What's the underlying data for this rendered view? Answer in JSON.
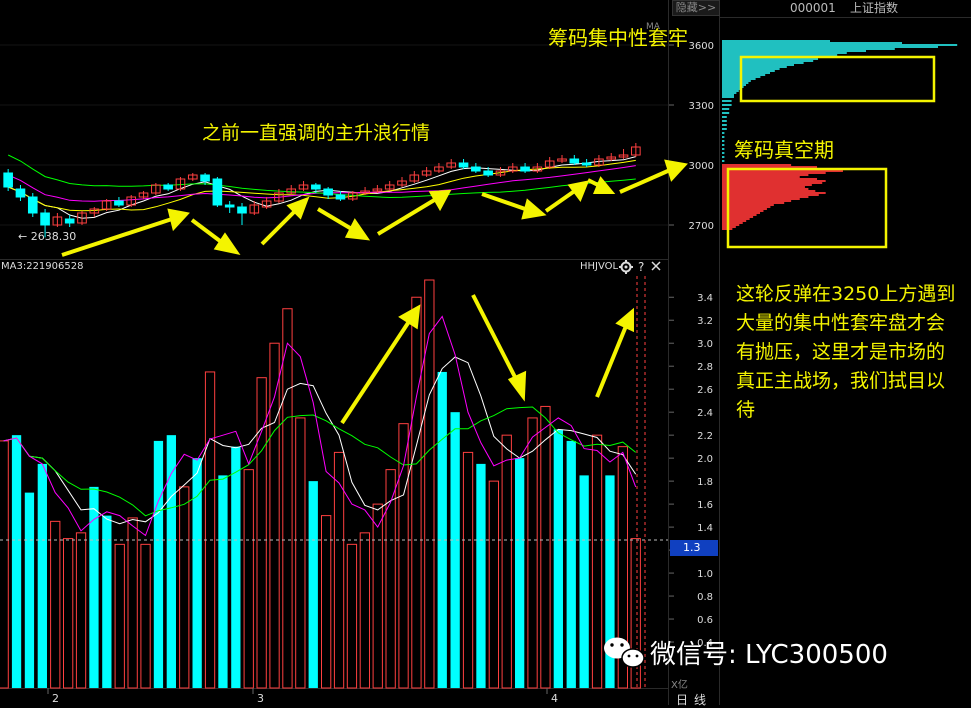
{
  "toolbar": {
    "hide_label": "隐藏>>"
  },
  "stock": {
    "code": "000001",
    "name": "上证指数"
  },
  "annotations": {
    "trapped": "筹码集中性套牢",
    "uptrend": "之前一直强调的主升浪行情",
    "vacuum": "筹码真空期",
    "note": "这轮反弹在3250上方遇到大量的集中性套牢盘才会有抛压，这里才是市场的真正主战场，我们拭目以待"
  },
  "price_panel": {
    "low_label": "← 2638.30",
    "axis_ticks": [
      "3600",
      "3300",
      "3000",
      "2700"
    ],
    "ma_marker": "MA"
  },
  "volume_panel": {
    "indicator_label": "MA3:221906528",
    "indicator_name": "HHJVOL",
    "axis_ticks": [
      "3.4",
      "3.2",
      "3.0",
      "2.8",
      "2.6",
      "2.4",
      "2.2",
      "2.0",
      "1.8",
      "1.6",
      "1.4",
      "1.2",
      "1.0",
      "0.8",
      "0.6",
      "0.4"
    ],
    "current_value": "1.3",
    "unit": "X亿"
  },
  "time_axis": {
    "labels": [
      "2",
      "3",
      "4"
    ]
  },
  "period_label": "日线",
  "watermark": "微信号: LYC300500",
  "colors": {
    "up": "#ff4040",
    "down": "#00ffff",
    "highlight": "#f4f400",
    "ma_white": "#ffffff",
    "ma_yellow": "#ffff00",
    "ma_magenta": "#ff00ff",
    "ma_green": "#00ff00"
  },
  "chart_data": [
    {
      "type": "candlestick",
      "title": "上证指数",
      "ylim": [
        2550,
        3800
      ],
      "yticks": [
        2700,
        3000,
        3300,
        3600
      ],
      "x_labels": [
        "2",
        "3",
        "4"
      ],
      "low_marker": 2638.3,
      "candles": [
        {
          "o": 2960,
          "c": 2890,
          "h": 2980,
          "l": 2870
        },
        {
          "o": 2880,
          "c": 2840,
          "h": 2900,
          "l": 2820
        },
        {
          "o": 2840,
          "c": 2760,
          "h": 2860,
          "l": 2740
        },
        {
          "o": 2760,
          "c": 2700,
          "h": 2780,
          "l": 2638
        },
        {
          "o": 2700,
          "c": 2740,
          "h": 2760,
          "l": 2690
        },
        {
          "o": 2730,
          "c": 2710,
          "h": 2750,
          "l": 2690
        },
        {
          "o": 2710,
          "c": 2760,
          "h": 2770,
          "l": 2700
        },
        {
          "o": 2760,
          "c": 2780,
          "h": 2790,
          "l": 2740
        },
        {
          "o": 2780,
          "c": 2820,
          "h": 2830,
          "l": 2770
        },
        {
          "o": 2820,
          "c": 2800,
          "h": 2840,
          "l": 2790
        },
        {
          "o": 2800,
          "c": 2840,
          "h": 2850,
          "l": 2790
        },
        {
          "o": 2840,
          "c": 2860,
          "h": 2870,
          "l": 2830
        },
        {
          "o": 2860,
          "c": 2900,
          "h": 2910,
          "l": 2850
        },
        {
          "o": 2900,
          "c": 2880,
          "h": 2910,
          "l": 2870
        },
        {
          "o": 2880,
          "c": 2930,
          "h": 2940,
          "l": 2870
        },
        {
          "o": 2930,
          "c": 2950,
          "h": 2960,
          "l": 2920
        },
        {
          "o": 2950,
          "c": 2920,
          "h": 2960,
          "l": 2900
        },
        {
          "o": 2930,
          "c": 2800,
          "h": 2940,
          "l": 2790
        },
        {
          "o": 2800,
          "c": 2790,
          "h": 2820,
          "l": 2760
        },
        {
          "o": 2790,
          "c": 2760,
          "h": 2810,
          "l": 2700
        },
        {
          "o": 2760,
          "c": 2800,
          "h": 2820,
          "l": 2750
        },
        {
          "o": 2790,
          "c": 2820,
          "h": 2840,
          "l": 2780
        },
        {
          "o": 2820,
          "c": 2860,
          "h": 2880,
          "l": 2810
        },
        {
          "o": 2860,
          "c": 2880,
          "h": 2900,
          "l": 2850
        },
        {
          "o": 2880,
          "c": 2900,
          "h": 2920,
          "l": 2870
        },
        {
          "o": 2900,
          "c": 2880,
          "h": 2910,
          "l": 2860
        },
        {
          "o": 2880,
          "c": 2850,
          "h": 2890,
          "l": 2830
        },
        {
          "o": 2850,
          "c": 2830,
          "h": 2870,
          "l": 2820
        },
        {
          "o": 2830,
          "c": 2860,
          "h": 2870,
          "l": 2820
        },
        {
          "o": 2860,
          "c": 2870,
          "h": 2890,
          "l": 2850
        },
        {
          "o": 2870,
          "c": 2880,
          "h": 2900,
          "l": 2860
        },
        {
          "o": 2880,
          "c": 2900,
          "h": 2920,
          "l": 2870
        },
        {
          "o": 2900,
          "c": 2920,
          "h": 2940,
          "l": 2890
        },
        {
          "o": 2920,
          "c": 2950,
          "h": 2970,
          "l": 2910
        },
        {
          "o": 2950,
          "c": 2970,
          "h": 2990,
          "l": 2940
        },
        {
          "o": 2970,
          "c": 2990,
          "h": 3010,
          "l": 2960
        },
        {
          "o": 2990,
          "c": 3010,
          "h": 3030,
          "l": 2980
        },
        {
          "o": 3010,
          "c": 2990,
          "h": 3030,
          "l": 2980
        },
        {
          "o": 2990,
          "c": 2970,
          "h": 3010,
          "l": 2960
        },
        {
          "o": 2970,
          "c": 2950,
          "h": 2990,
          "l": 2940
        },
        {
          "o": 2950,
          "c": 2970,
          "h": 2990,
          "l": 2940
        },
        {
          "o": 2970,
          "c": 2990,
          "h": 3010,
          "l": 2960
        },
        {
          "o": 2990,
          "c": 2970,
          "h": 3010,
          "l": 2960
        },
        {
          "o": 2970,
          "c": 2990,
          "h": 3010,
          "l": 2960
        },
        {
          "o": 2990,
          "c": 3020,
          "h": 3040,
          "l": 2980
        },
        {
          "o": 3020,
          "c": 3030,
          "h": 3050,
          "l": 3010
        },
        {
          "o": 3030,
          "c": 3010,
          "h": 3050,
          "l": 3000
        },
        {
          "o": 3010,
          "c": 3000,
          "h": 3030,
          "l": 2990
        },
        {
          "o": 3000,
          "c": 3030,
          "h": 3050,
          "l": 2990
        },
        {
          "o": 3030,
          "c": 3040,
          "h": 3060,
          "l": 3020
        },
        {
          "o": 3040,
          "c": 3050,
          "h": 3080,
          "l": 3030
        },
        {
          "o": 3050,
          "c": 3090,
          "h": 3110,
          "l": 3040
        }
      ],
      "ma_series": [
        "white",
        "yellow",
        "magenta",
        "green"
      ]
    },
    {
      "type": "bar",
      "title": "HHJVOL",
      "ylabel": "X亿",
      "ylim": [
        0,
        3.55
      ],
      "yticks": [
        3.4,
        3.2,
        3.0,
        2.8,
        2.6,
        2.4,
        2.2,
        2.0,
        1.8,
        1.6,
        1.4,
        1.2,
        1.0,
        0.8,
        0.6,
        0.4
      ],
      "values": [
        2.15,
        2.2,
        1.7,
        1.95,
        1.45,
        1.3,
        1.35,
        1.75,
        1.5,
        1.25,
        1.48,
        1.25,
        2.15,
        2.2,
        1.75,
        2.0,
        2.75,
        1.85,
        2.1,
        1.9,
        2.7,
        3.0,
        3.3,
        2.35,
        1.8,
        1.5,
        2.05,
        1.25,
        1.35,
        1.6,
        1.9,
        2.3,
        3.4,
        3.55,
        2.75,
        2.4,
        2.05,
        1.95,
        1.8,
        2.2,
        2.0,
        2.35,
        2.45,
        2.25,
        2.15,
        1.85,
        2.2,
        1.85,
        2.1,
        1.3
      ],
      "up": [
        true,
        false,
        false,
        false,
        true,
        true,
        true,
        false,
        false,
        true,
        true,
        true,
        false,
        false,
        true,
        false,
        true,
        false,
        false,
        true,
        true,
        true,
        true,
        true,
        false,
        true,
        true,
        true,
        true,
        true,
        true,
        true,
        true,
        true,
        false,
        false,
        true,
        false,
        true,
        true,
        false,
        true,
        true,
        false,
        false,
        false,
        true,
        false,
        true,
        true
      ],
      "series_ma": [
        "white",
        "green",
        "magenta"
      ]
    },
    {
      "type": "bar",
      "title": "筹码分布",
      "orientation": "horizontal",
      "y_range": [
        2550,
        3800
      ],
      "bins_up": [
        3620,
        3610,
        3600,
        3590,
        3580,
        3570,
        3560,
        3550,
        3540,
        3530,
        3520,
        3510,
        3500,
        3490,
        3480,
        3470,
        3460,
        3450,
        3440,
        3430,
        3420,
        3410,
        3400,
        3390,
        3380,
        3370,
        3360,
        3350,
        3340,
        3320,
        3300,
        3280,
        3260,
        3240,
        3220,
        3200,
        3180,
        3160,
        3140,
        3120,
        3100,
        3080,
        3060,
        3040,
        3020
      ],
      "weights_up": [
        0.45,
        0.75,
        0.98,
        0.9,
        0.72,
        0.6,
        0.52,
        0.48,
        0.44,
        0.4,
        0.38,
        0.34,
        0.3,
        0.27,
        0.24,
        0.22,
        0.2,
        0.18,
        0.16,
        0.14,
        0.12,
        0.11,
        0.1,
        0.09,
        0.08,
        0.07,
        0.06,
        0.05,
        0.05,
        0.04,
        0.04,
        0.03,
        0.03,
        0.02,
        0.02,
        0.02,
        0.02,
        0.01,
        0.01,
        0.01,
        0.01,
        0.01,
        0.01,
        0.01,
        0.01
      ],
      "bins_low": [
        3000,
        2990,
        2980,
        2970,
        2960,
        2950,
        2940,
        2930,
        2920,
        2910,
        2900,
        2890,
        2880,
        2870,
        2860,
        2850,
        2840,
        2830,
        2820,
        2810,
        2800,
        2790,
        2780,
        2770,
        2760,
        2750,
        2740,
        2730,
        2720,
        2710,
        2700,
        2690,
        2680
      ],
      "weights_low": [
        0.4,
        0.55,
        0.65,
        0.7,
        0.6,
        0.5,
        0.45,
        0.55,
        0.6,
        0.58,
        0.52,
        0.48,
        0.5,
        0.54,
        0.6,
        0.56,
        0.5,
        0.45,
        0.4,
        0.36,
        0.3,
        0.28,
        0.26,
        0.24,
        0.22,
        0.2,
        0.18,
        0.16,
        0.14,
        0.12,
        0.1,
        0.08,
        0.06
      ]
    }
  ]
}
